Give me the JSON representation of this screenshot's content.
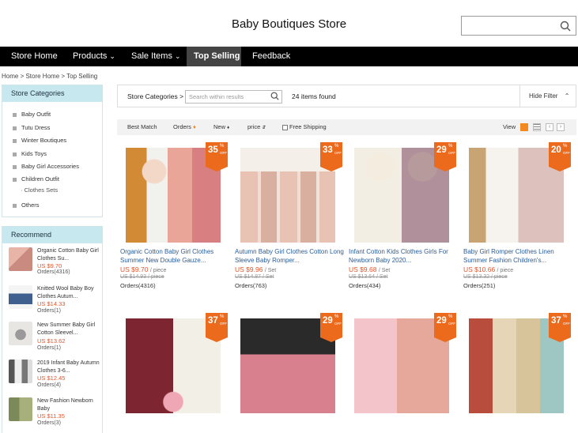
{
  "store": {
    "title": "Baby Boutiques Store",
    "search_placeholder": ""
  },
  "nav": [
    {
      "label": "Store Home",
      "dropdown": false,
      "active": false
    },
    {
      "label": "Products",
      "dropdown": true,
      "active": false
    },
    {
      "label": "Sale Items",
      "dropdown": true,
      "active": false
    },
    {
      "label": "Top Selling",
      "dropdown": false,
      "active": true
    },
    {
      "label": "Feedback",
      "dropdown": false,
      "active": false
    }
  ],
  "breadcrumb": "Home > Store Home > Top Selling",
  "sidebar": {
    "categories_title": "Store Categories",
    "categories": [
      "Baby Outfit",
      "Tutu Dress",
      "Winter Boutiques",
      "Kids Toys",
      "Baby Girl Accessories",
      "Children Outfit",
      "Clothes Sets",
      "Others"
    ],
    "recommend_title": "Recommend",
    "recommend": [
      {
        "title": "Organic Cotton Baby Girl Clothes Su...",
        "price": "US $9.70",
        "orders": "Orders(4316)"
      },
      {
        "title": "Knitted Wool Baby Boy Clothes Autum...",
        "price": "US $14.33",
        "orders": "Orders(1)"
      },
      {
        "title": "New Summer Baby Girl Cotton Sleevel...",
        "price": "US $13.62",
        "orders": "Orders(1)"
      },
      {
        "title": "2019 Infant Baby Autumn Clothes 3-6...",
        "price": "US $12.45",
        "orders": "Orders(4)"
      },
      {
        "title": "New Fashion Newborn Baby",
        "price": "US $11.35",
        "orders": "Orders(3)"
      }
    ]
  },
  "toolbar": {
    "categories_label": "Store Categories >",
    "search_placeholder": "Search within results",
    "count": "24 items found",
    "hide_filter": "Hide Filter"
  },
  "sort": {
    "best_match": "Best Match",
    "orders": "Orders",
    "new": "New",
    "price": "price",
    "free_shipping": "Free Shipping",
    "view": "View"
  },
  "products": [
    {
      "discount": "35",
      "title": "Organic Cotton Baby Girl Clothes Summer New Double Gauze...",
      "price": "US $9.70",
      "unit": "/ piece",
      "old": "US $14.93 / piece",
      "orders": "Orders(4316)"
    },
    {
      "discount": "33",
      "title": "Autumn Baby Girl Clothes Cotton Long Sleeve Baby Romper...",
      "price": "US $9.96",
      "unit": "/ Set",
      "old": "US $14.87 / Set",
      "orders": "Orders(763)"
    },
    {
      "discount": "29",
      "title": "Infant Cotton Kids Clothes Girls For Newborn Baby 2020...",
      "price": "US $9.68",
      "unit": "/ Set",
      "old": "US $13.64 / Set",
      "orders": "Orders(434)"
    },
    {
      "discount": "20",
      "title": "Baby Girl Romper Clothes Linen Summer Fashion Children's...",
      "price": "US $10.66",
      "unit": "/ piece",
      "old": "US $13.32 / piece",
      "orders": "Orders(251)"
    },
    {
      "discount": "37",
      "title": "",
      "price": "",
      "unit": "",
      "old": "",
      "orders": ""
    },
    {
      "discount": "29",
      "title": "",
      "price": "",
      "unit": "",
      "old": "",
      "orders": ""
    },
    {
      "discount": "29",
      "title": "",
      "price": "",
      "unit": "",
      "old": "",
      "orders": ""
    },
    {
      "discount": "37",
      "title": "",
      "price": "",
      "unit": "",
      "old": "",
      "orders": ""
    }
  ],
  "badge": {
    "percent": "%",
    "off": "OFF"
  },
  "colors": {
    "accent": "#ec6a1c",
    "nav_bg": "#000000",
    "sidebar_head": "#c6e8ee",
    "price": "#e2552a",
    "link": "#2a5d9a"
  }
}
